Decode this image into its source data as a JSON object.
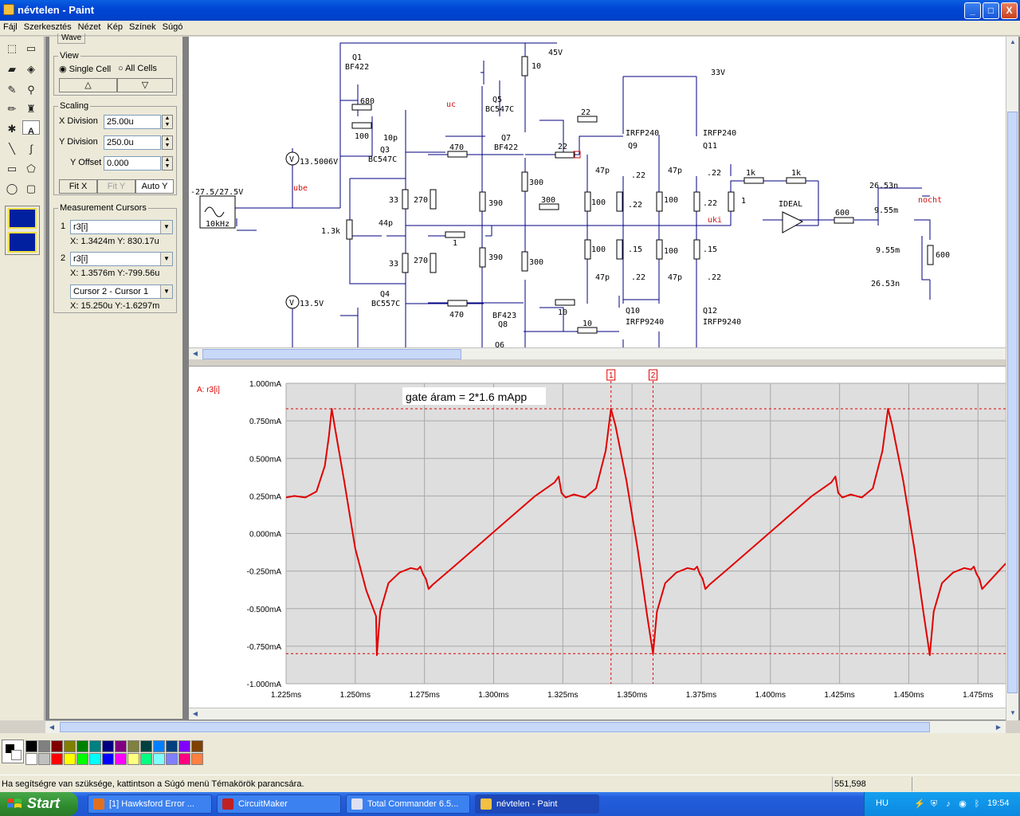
{
  "window": {
    "title": "névtelen - Paint",
    "controls": {
      "min": "_",
      "max": "□",
      "close": "X"
    }
  },
  "menu": [
    "Fájl",
    "Szerkesztés",
    "Nézet",
    "Kép",
    "Színek",
    "Súgó"
  ],
  "toolbox": {
    "icons": [
      "select-free-icon",
      "select-rect-icon",
      "eraser-icon",
      "fill-icon",
      "picker-icon",
      "magnifier-icon",
      "pencil-icon",
      "brush-icon",
      "airbrush-icon",
      "text-icon",
      "line-icon",
      "curve-icon",
      "rectangle-icon",
      "polygon-icon",
      "ellipse-icon",
      "rounded-rect-icon"
    ]
  },
  "panel": {
    "tab_label": "Wave",
    "view": {
      "title": "View",
      "single_cell": "Single Cell",
      "all_cells": "All Cells",
      "up": "△",
      "down": "▽"
    },
    "scaling": {
      "title": "Scaling",
      "x_div_label": "X Division",
      "x_div_value": "25.00u",
      "y_div_label": "Y Division",
      "y_div_value": "250.0u",
      "y_off_label": "Y Offset",
      "y_off_value": "0.000",
      "fit_x": "Fit X",
      "fit_y": "Fit Y",
      "auto_y": "Auto Y"
    },
    "cursors": {
      "title": "Measurement Cursors",
      "c1_num": "1",
      "c1_sel": "r3[i]",
      "c1_read": "X: 1.3424m  Y: 830.17u",
      "c2_num": "2",
      "c2_sel": "r3[i]",
      "c2_read": "X: 1.3576m  Y:-799.56u",
      "diff_sel": "Cursor 2 - Cursor 1",
      "diff_read": "X: 15.250u  Y:-1.6297m"
    }
  },
  "schematic": {
    "labels": {
      "q1": "Q1",
      "q1t": "BF422",
      "v45": "45V",
      "v33": "33V",
      "q5": "Q5",
      "q5t": "BC547C",
      "uc": "uc",
      "q7": "Q7",
      "q7t": "BF422",
      "q3": "Q3",
      "q3t": "BC547C",
      "q4": "Q4",
      "q4t": "BC557C",
      "q8": "Q8",
      "q8t": "BF423",
      "q6": "Q6",
      "q9": "Q9",
      "q9t": "IRFP240",
      "q11": "Q11",
      "q11t": "IRFP240",
      "q10": "Q10",
      "q10t": "IRFP9240",
      "q12": "Q12",
      "q12t": "IRFP9240",
      "ube": "ube",
      "uki": "uki",
      "nocht": "nocht",
      "src": "-27.5/27.5V",
      "freq": "10kHz",
      "vm1": "13.5006V",
      "vm2": "13.5V",
      "vsym": "V",
      "ideal": "IDEAL",
      "r680": "680",
      "r100": "100",
      "c10p": "10p",
      "r470": "470",
      "r33": "33",
      "r270": "270",
      "r390": "390",
      "r1k3": "1.3k",
      "c44p": "44p",
      "r1": "1",
      "r10": "10",
      "r300": "300",
      "r22": "22",
      "c47p": "47p",
      "r022": ".22",
      "r015": ".15",
      "r1k": "1k",
      "r600": "600",
      "c2653": "26.53n",
      "l955": "9.55m"
    }
  },
  "plot": {
    "trace_label": "A: r3[i]",
    "annotation": "gate áram = 2*1.6 mApp",
    "cursor1": "1",
    "cursor2": "2",
    "colors": {
      "trace": "#e00000",
      "grid": "#a8a8a8",
      "bg": "#dedede",
      "cursor": "#e00000"
    }
  },
  "chart_data": {
    "type": "line",
    "title": "",
    "xlabel": "",
    "ylabel": "",
    "xlim": [
      1.225,
      1.485
    ],
    "ylim": [
      -1.0,
      1.0
    ],
    "x_ticks": [
      1.225,
      1.25,
      1.275,
      1.3,
      1.325,
      1.35,
      1.375,
      1.4,
      1.425,
      1.45,
      1.475
    ],
    "x_tick_labels": [
      "1.225ms",
      "1.250ms",
      "1.275ms",
      "1.300ms",
      "1.325ms",
      "1.350ms",
      "1.375ms",
      "1.400ms",
      "1.425ms",
      "1.450ms",
      "1.475ms"
    ],
    "y_ticks": [
      1.0,
      0.75,
      0.5,
      0.25,
      0.0,
      -0.25,
      -0.5,
      -0.75,
      -1.0
    ],
    "y_tick_labels": [
      "1.000mA",
      "0.750mA",
      "0.500mA",
      "0.250mA",
      "0.000mA",
      "-0.250mA",
      "-0.500mA",
      "-0.750mA",
      "-1.000mA"
    ],
    "grid": true,
    "cursor_x": [
      1.3424,
      1.3576
    ],
    "cursor_y": [
      0.83,
      -0.8
    ],
    "series": [
      {
        "name": "A: r3[i]",
        "x": [
          1.225,
          1.228,
          1.232,
          1.236,
          1.239,
          1.2405,
          1.2415,
          1.2425,
          1.246,
          1.25,
          1.254,
          1.2575,
          1.2578,
          1.259,
          1.262,
          1.266,
          1.27,
          1.2725,
          1.2735,
          1.2745,
          1.2755,
          1.2765,
          1.278,
          1.285,
          1.295,
          1.305,
          1.315,
          1.322,
          1.3235,
          1.3245,
          1.326,
          1.329,
          1.333,
          1.337,
          1.3405,
          1.3424,
          1.344,
          1.348,
          1.352,
          1.3555,
          1.3576,
          1.359,
          1.362,
          1.366,
          1.37,
          1.3725,
          1.3735,
          1.3745,
          1.3755,
          1.3765,
          1.378,
          1.385,
          1.395,
          1.405,
          1.415,
          1.422,
          1.4235,
          1.4245,
          1.426,
          1.429,
          1.433,
          1.437,
          1.4405,
          1.4425,
          1.444,
          1.448,
          1.452,
          1.4555,
          1.4576,
          1.459,
          1.462,
          1.466,
          1.47,
          1.4725,
          1.4735,
          1.4745,
          1.4755,
          1.4765,
          1.478,
          1.485
        ],
        "y": [
          0.24,
          0.25,
          0.24,
          0.28,
          0.45,
          0.65,
          0.83,
          0.72,
          0.35,
          -0.1,
          -0.38,
          -0.55,
          -0.81,
          -0.52,
          -0.33,
          -0.26,
          -0.23,
          -0.24,
          -0.22,
          -0.27,
          -0.3,
          -0.37,
          -0.34,
          -0.23,
          -0.07,
          0.09,
          0.25,
          0.34,
          0.38,
          0.27,
          0.24,
          0.26,
          0.24,
          0.3,
          0.55,
          0.83,
          0.72,
          0.35,
          -0.1,
          -0.55,
          -0.8,
          -0.52,
          -0.33,
          -0.26,
          -0.23,
          -0.24,
          -0.22,
          -0.27,
          -0.3,
          -0.37,
          -0.34,
          -0.23,
          -0.07,
          0.09,
          0.25,
          0.34,
          0.38,
          0.27,
          0.24,
          0.26,
          0.24,
          0.3,
          0.55,
          0.83,
          0.72,
          0.35,
          -0.1,
          -0.55,
          -0.81,
          -0.52,
          -0.33,
          -0.26,
          -0.23,
          -0.24,
          -0.22,
          -0.27,
          -0.3,
          -0.37,
          -0.34,
          -0.2
        ]
      }
    ]
  },
  "palette": [
    "#000000",
    "#808080",
    "#800000",
    "#808000",
    "#008000",
    "#008080",
    "#000080",
    "#800080",
    "#808040",
    "#004040",
    "#0080ff",
    "#004080",
    "#8000ff",
    "#804000",
    "#ffffff",
    "#c0c0c0",
    "#ff0000",
    "#ffff00",
    "#00ff00",
    "#00ffff",
    "#0000ff",
    "#ff00ff",
    "#ffff80",
    "#00ff80",
    "#80ffff",
    "#8080ff",
    "#ff0080",
    "#ff8040"
  ],
  "status": {
    "help": "Ha segítségre van szüksége, kattintson a Súgó menü Témakörök parancsára.",
    "coords": "551,598"
  },
  "taskbar": {
    "start": "Start",
    "tasks": [
      "[1] Hawksford Error ...",
      "CircuitMaker",
      "Total Commander 6.5...",
      "névtelen - Paint"
    ],
    "lang": "HU",
    "clock": "19:54"
  }
}
